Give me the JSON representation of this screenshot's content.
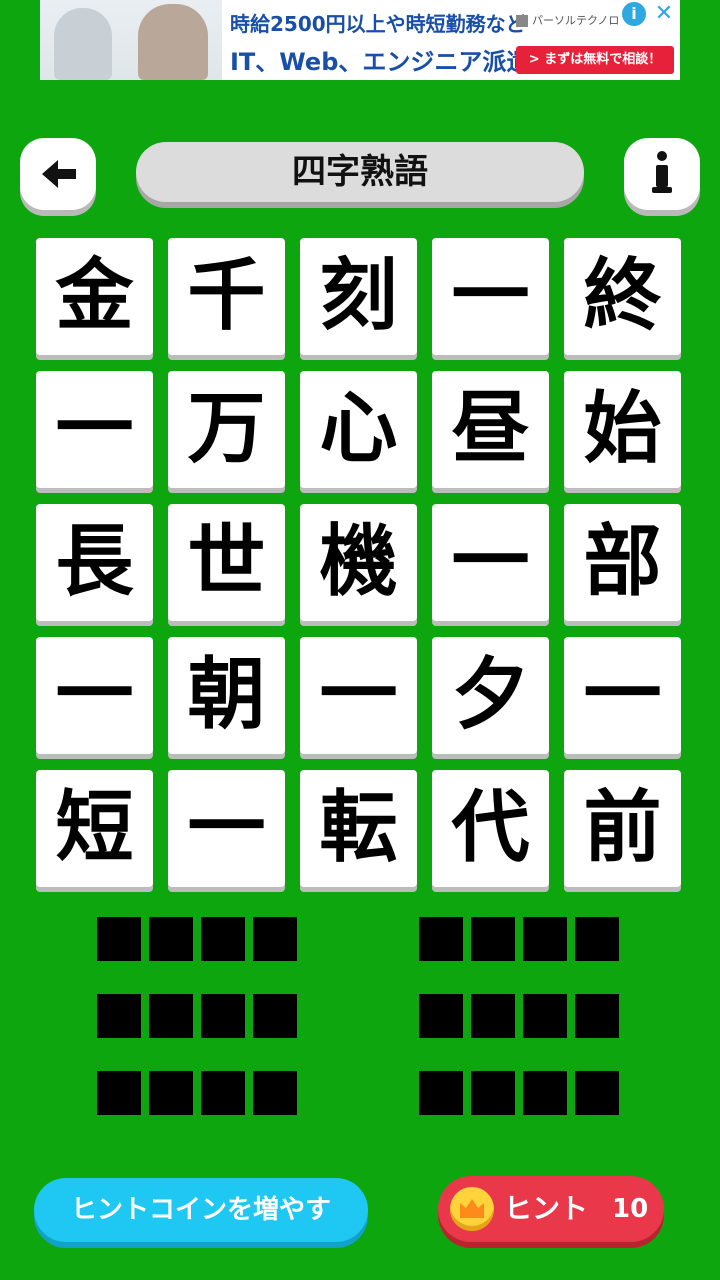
{
  "ad": {
    "line1": "時給2500円以上や時短勤務など",
    "line2": "IT、Web、エンジニア派遣",
    "brand": "パーソルテクノロ",
    "cta": "> まずは無料で相談！",
    "info_icon": "info-icon",
    "close_icon": "close-icon"
  },
  "header": {
    "title": "四字熟語",
    "back_icon": "back-arrow-icon",
    "info_icon": "info-icon"
  },
  "grid": {
    "tiles": [
      "金",
      "千",
      "刻",
      "一",
      "終",
      "一",
      "万",
      "心",
      "昼",
      "始",
      "長",
      "世",
      "機",
      "一",
      "部",
      "一",
      "朝",
      "一",
      "夕",
      "一",
      "短",
      "一",
      "転",
      "代",
      "前"
    ]
  },
  "answers": {
    "groups": 6,
    "cells_per_group": 4
  },
  "buttons": {
    "coin_label": "ヒントコインを増やす",
    "hint_label": "ヒント",
    "hint_count": "10",
    "coin_icon": "crown-coin-icon"
  },
  "colors": {
    "background": "#0da60f",
    "coin_button": "#1ec8f2",
    "hint_button": "#e8384a"
  }
}
